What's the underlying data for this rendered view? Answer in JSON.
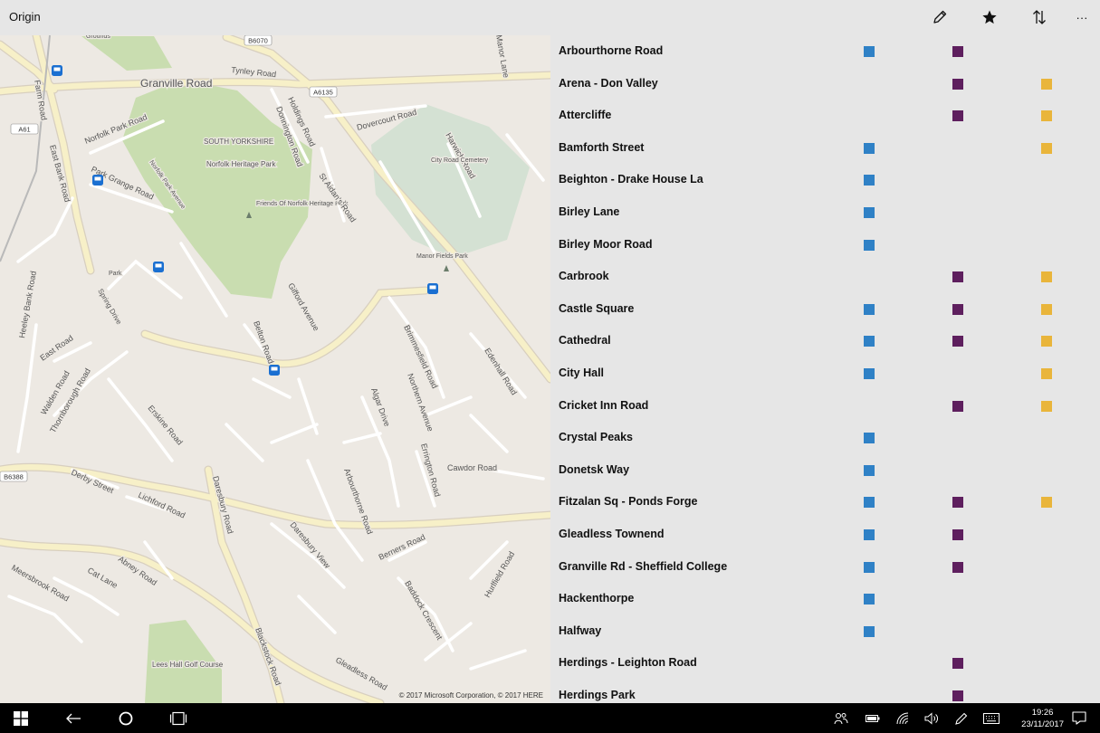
{
  "app": {
    "title": "Origin"
  },
  "toolbar": {
    "edit_icon": "pencil-icon",
    "favorite_icon": "star-icon",
    "sort_icon": "sort-arrows-icon",
    "more_label": "···"
  },
  "colors": {
    "blue": "#2f81c6",
    "purple": "#5e1f5e",
    "yellow": "#e9b53b"
  },
  "map": {
    "copyright": "© 2017 Microsoft Corporation, © 2017 HERE",
    "labels": [
      "Granville Road",
      "Tynley Road",
      "Norfolk Park Road",
      "Park Grange Road",
      "SOUTH YORKSHIRE",
      "Norfolk Heritage Park",
      "Friends Of Norfolk Heritage Park",
      "Norfolk Park Avenue",
      "Holdings Road",
      "Donnington Road",
      "St Aidan's Road",
      "Dovercourt Road",
      "Harwich Road",
      "City Road Cemetery",
      "Manor Fields Park",
      "Gifford Avenue",
      "Belton Road",
      "Brimmesfield Road",
      "Northern Avenue",
      "Edenhall Road",
      "Algar Drive",
      "Errington Road",
      "Cawdor Road",
      "Arbourthorne Road",
      "Daresbury Road",
      "Daresbury View",
      "Berners Road",
      "Hurlfield Road",
      "Baddock Crescent",
      "Lees Hall Golf Course",
      "Blackstock Road",
      "Gleadless Road",
      "Meersbrook Road",
      "Cat Lane",
      "Abney Road",
      "Derby Street",
      "Lichford Road",
      "Erskine Road",
      "East Road",
      "Walden Road",
      "Thornborough Road",
      "Heeley Bank Road",
      "Spring Drive",
      "East Bank Road",
      "Farm Road",
      "Manor Lane",
      "Grounds",
      "Park"
    ],
    "road_badges": [
      "B6070",
      "A6135",
      "A61",
      "B6388"
    ]
  },
  "stops": [
    {
      "name": "Arbourthorne Road",
      "blue": true,
      "purple": true,
      "yellow": false
    },
    {
      "name": "Arena - Don Valley",
      "blue": false,
      "purple": true,
      "yellow": true
    },
    {
      "name": "Attercliffe",
      "blue": false,
      "purple": true,
      "yellow": true
    },
    {
      "name": "Bamforth Street",
      "blue": true,
      "purple": false,
      "yellow": true
    },
    {
      "name": "Beighton - Drake House La",
      "blue": true,
      "purple": false,
      "yellow": false
    },
    {
      "name": "Birley Lane",
      "blue": true,
      "purple": false,
      "yellow": false
    },
    {
      "name": "Birley Moor Road",
      "blue": true,
      "purple": false,
      "yellow": false
    },
    {
      "name": "Carbrook",
      "blue": false,
      "purple": true,
      "yellow": true
    },
    {
      "name": "Castle Square",
      "blue": true,
      "purple": true,
      "yellow": true
    },
    {
      "name": "Cathedral",
      "blue": true,
      "purple": true,
      "yellow": true
    },
    {
      "name": "City Hall",
      "blue": true,
      "purple": false,
      "yellow": true
    },
    {
      "name": "Cricket Inn Road",
      "blue": false,
      "purple": true,
      "yellow": true
    },
    {
      "name": "Crystal Peaks",
      "blue": true,
      "purple": false,
      "yellow": false
    },
    {
      "name": "Donetsk Way",
      "blue": true,
      "purple": false,
      "yellow": false
    },
    {
      "name": "Fitzalan Sq - Ponds Forge",
      "blue": true,
      "purple": true,
      "yellow": true
    },
    {
      "name": "Gleadless Townend",
      "blue": true,
      "purple": true,
      "yellow": false
    },
    {
      "name": "Granville Rd - Sheffield College",
      "blue": true,
      "purple": true,
      "yellow": false
    },
    {
      "name": "Hackenthorpe",
      "blue": true,
      "purple": false,
      "yellow": false
    },
    {
      "name": "Halfway",
      "blue": true,
      "purple": false,
      "yellow": false
    },
    {
      "name": "Herdings - Leighton Road",
      "blue": false,
      "purple": true,
      "yellow": false
    },
    {
      "name": "Herdings Park",
      "blue": false,
      "purple": true,
      "yellow": false
    }
  ],
  "taskbar": {
    "time": "19:26",
    "date": "23/11/2017"
  }
}
